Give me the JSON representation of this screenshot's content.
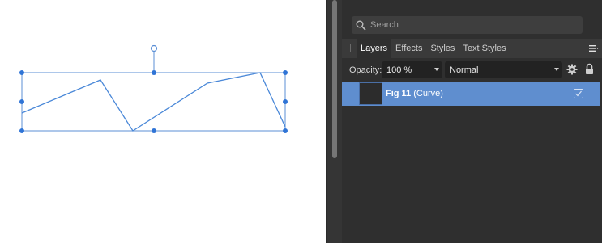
{
  "search": {
    "placeholder": "Search"
  },
  "tabs": [
    {
      "label": "Layers",
      "active": true
    },
    {
      "label": "Effects",
      "active": false
    },
    {
      "label": "Styles",
      "active": false
    },
    {
      "label": "Text Styles",
      "active": false
    }
  ],
  "controls": {
    "opacity_label": "Opacity:",
    "opacity_value": "100 %",
    "blend_mode": "Normal"
  },
  "layer": {
    "name": "Fig 11",
    "type": "(Curve)",
    "visible": true
  },
  "colors": {
    "selection": "#5b8fd6",
    "curve_stroke": "#4a88d8",
    "panel_bg": "#2f2f2f",
    "row_highlight": "#5f8ecf"
  }
}
